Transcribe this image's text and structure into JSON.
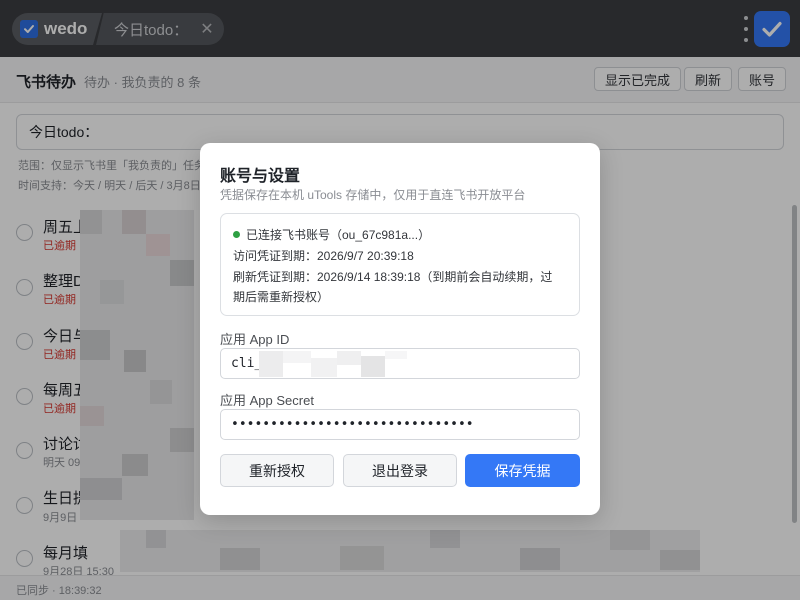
{
  "topbar": {
    "tab_main_label": "wedo",
    "tab_sub_label": "今日todo：",
    "accent": "#3478f6"
  },
  "header": {
    "title": "飞书待办",
    "subtitle": "待办 · 我负责的 8 条",
    "buttons": [
      "显示已完成",
      "刷新",
      "账号"
    ]
  },
  "input": {
    "value": "今日todo："
  },
  "hints": {
    "scope": "范围：仅显示飞书里「我负责的」任务",
    "time": "时间支持：今天 / 明天 / 后天 / 3月8日"
  },
  "tasks": [
    {
      "title": "周五上",
      "sub": "已逾期 ·",
      "overdue": true
    },
    {
      "title": "整理D",
      "sub": "已逾期 ·",
      "overdue": true
    },
    {
      "title": "今日与",
      "sub": "已逾期 ·",
      "overdue": true
    },
    {
      "title": "每周五",
      "sub": "已逾期 ·",
      "overdue": true
    },
    {
      "title": "讨论讨",
      "sub": "明天 09",
      "overdue": false
    },
    {
      "title": "生日提",
      "sub": "9月9日",
      "overdue": false
    },
    {
      "title": "每月填",
      "sub": "9月28日 15:30",
      "overdue": false
    }
  ],
  "footer": {
    "sync_text": "已同步 · 18:39:32"
  },
  "modal": {
    "title": "账号与设置",
    "description": "凭据保存在本机 uTools 存储中，仅用于直连飞书开放平台",
    "status": {
      "connected": "已连接飞书账号（ou_67c981a...）",
      "access_expiry": "访问凭证到期：2026/9/7 20:39:18",
      "refresh_expiry_line1": "刷新凭证到期：2026/9/14 18:39:18（到期前会自动续期，过",
      "refresh_expiry_line2": "期后需重新授权）"
    },
    "app_id_label": "应用 App ID",
    "app_id_value": "cli_",
    "app_secret_label": "应用 App Secret",
    "app_secret_value": "•••••••••••••••••••••••••••••••",
    "buttons": {
      "reauth": "重新授权",
      "logout": "退出登录",
      "save": "保存凭据"
    }
  }
}
